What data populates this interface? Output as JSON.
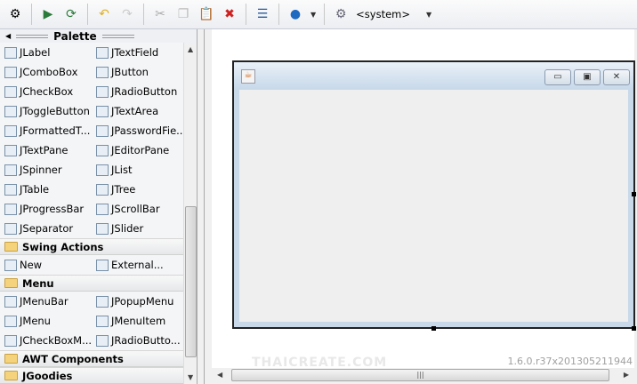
{
  "toolbar": {
    "items": [
      "inspector-icon",
      "source-icon",
      "refresh-icon",
      "undo-icon",
      "redo-icon",
      "cut-icon",
      "copy-icon",
      "paste-icon",
      "delete-icon",
      "align-icon",
      "globe-icon"
    ],
    "lookandfeel": "<system>"
  },
  "palette": {
    "title": "Palette",
    "sections": [
      {
        "items": [
          [
            "JLabel",
            "JTextField"
          ],
          [
            "JComboBox",
            "JButton"
          ],
          [
            "JCheckBox",
            "JRadioButton"
          ],
          [
            "JToggleButton",
            "JTextArea"
          ],
          [
            "JFormattedT...",
            "JPasswordFie..."
          ],
          [
            "JTextPane",
            "JEditorPane"
          ],
          [
            "JSpinner",
            "JList"
          ],
          [
            "JTable",
            "JTree"
          ],
          [
            "JProgressBar",
            "JScrollBar"
          ],
          [
            "JSeparator",
            "JSlider"
          ]
        ]
      },
      {
        "category": "Swing Actions",
        "items": [
          [
            "New",
            "External..."
          ]
        ]
      },
      {
        "category": "Menu",
        "items": [
          [
            "JMenuBar",
            "JPopupMenu"
          ],
          [
            "JMenu",
            "JMenuItem"
          ],
          [
            "JCheckBoxM...",
            "JRadioButto..."
          ]
        ]
      },
      {
        "category": "AWT Components",
        "items": []
      },
      {
        "category": "JGoodies",
        "items": []
      }
    ]
  },
  "design": {
    "version": "1.6.0.r37x201305211944",
    "watermark": "THAICREATE.COM"
  }
}
